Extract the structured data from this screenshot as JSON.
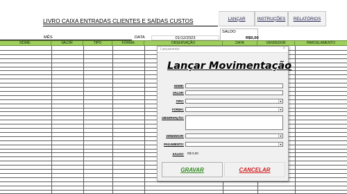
{
  "sheet": {
    "title": "LIVRO CAIXA ENTRADAS CLIENTES E SAÍDAS CUSTOS",
    "mes_label": "MÊS",
    "data_label": "DATA",
    "date_value": "01/12/2023",
    "saldo_label": "SALDO",
    "saldo_value": "R$0,00"
  },
  "toolbar": {
    "lancar": "LANÇAR",
    "instrucoes": "INSTRUÇÕES",
    "relatorios": "RELATÓRIOS"
  },
  "table": {
    "columns": [
      "NOME:",
      "VALOR",
      "TIPO",
      "FORMA",
      "OBSERVAÇÃO",
      "DATA",
      "VENDEDOR",
      "PARCELAMENTO"
    ]
  },
  "dialog": {
    "window_title": "Lançamento",
    "close_glyph": "×",
    "heading": "Lançar Movimentação",
    "fields": {
      "nome": "NOME:",
      "valor": "VALOR:",
      "tipo": "TIPO:",
      "forma": "FORMA:",
      "observacao": "OBSERVAÇÃO:",
      "vendedor": "VENDEDOR:",
      "pagamento": "PAGAMENTO:",
      "saldo": "SALDO:"
    },
    "saldo_value": "R$ 0,00",
    "dropdown_glyph": "▾",
    "buttons": {
      "gravar": "GRAVAR",
      "cancelar": "CANCELAR"
    }
  },
  "colors": {
    "header_green": "#9ccf5c",
    "gravar_green": "#2f8a1c",
    "cancelar_red": "#d21b1b"
  }
}
